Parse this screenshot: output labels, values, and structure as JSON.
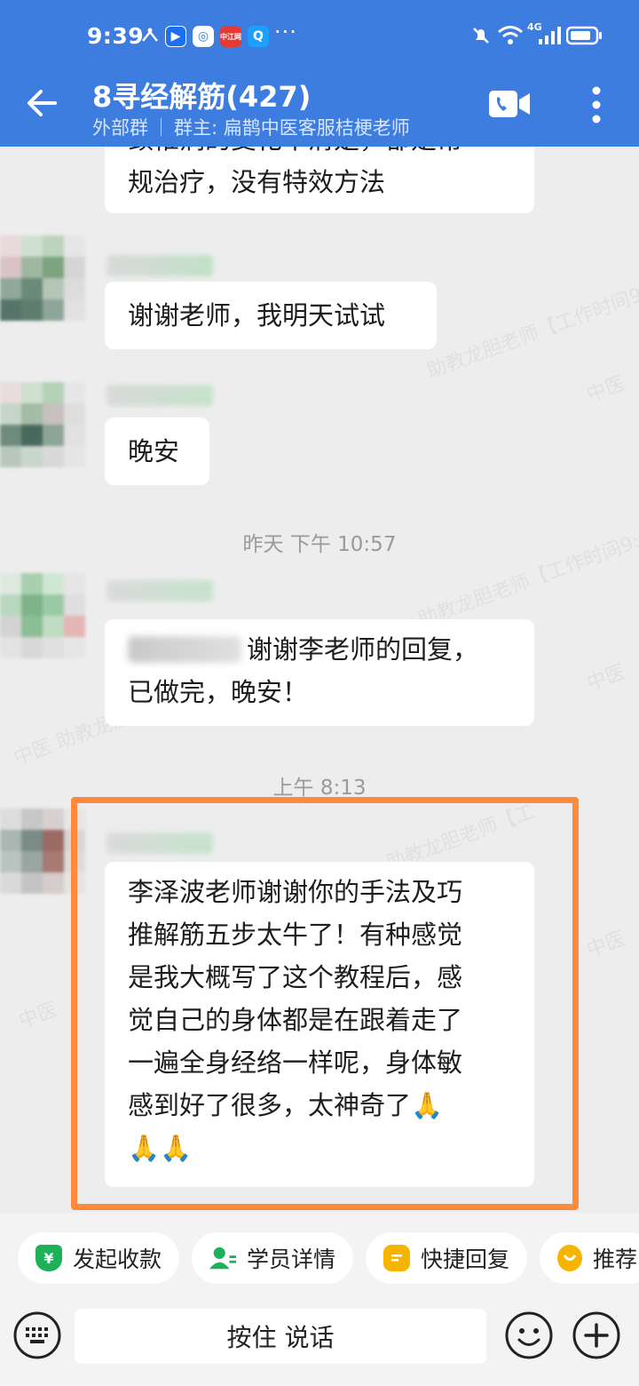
{
  "status_bar": {
    "time": "9:39",
    "network": "4G",
    "app_badge": "中江网"
  },
  "header": {
    "title": "8寻经解筋(427)",
    "tag": "外部群",
    "owner": "群主: 扁鹊中医客服桔梗老师"
  },
  "messages": [
    {
      "text_lines": [
        "颈椎病的变化不清楚，都是常",
        "规治疗，没有特效方法"
      ]
    },
    {
      "text_lines": [
        "谢谢老师，我明天试试"
      ]
    },
    {
      "text_lines": [
        "晚安"
      ]
    },
    {
      "timestamp": "昨天  下午 10:57"
    },
    {
      "text_lines": [
        "谢谢李老师的回复，",
        "已做完，晚安！"
      ]
    },
    {
      "timestamp": "上午 8:13"
    },
    {
      "text_lines": [
        "李泽波老师谢谢你的手法及巧",
        "推解筋五步太牛了！有种感觉",
        "是我大概写了这个教程后，感",
        "觉自己的身体都是在跟着走了",
        "一遍全身经络一样呢，身体敏",
        "感到好了很多，太神奇了🙏",
        "🙏🙏"
      ]
    }
  ],
  "quick_actions": [
    {
      "label": "发起收款",
      "icon": "payment-icon",
      "color": "#1fb05a"
    },
    {
      "label": "学员详情",
      "icon": "student-icon",
      "color": "#1fb05a"
    },
    {
      "label": "快捷回复",
      "icon": "quick-reply-icon",
      "color": "#f5b400"
    },
    {
      "label": "推荐",
      "icon": "recommend-icon",
      "color": "#f5b400"
    }
  ],
  "input": {
    "hold_to_talk": "按住 说话"
  },
  "colors": {
    "header_bg": "#3e7de0",
    "highlight_border": "#ff8a3d"
  }
}
